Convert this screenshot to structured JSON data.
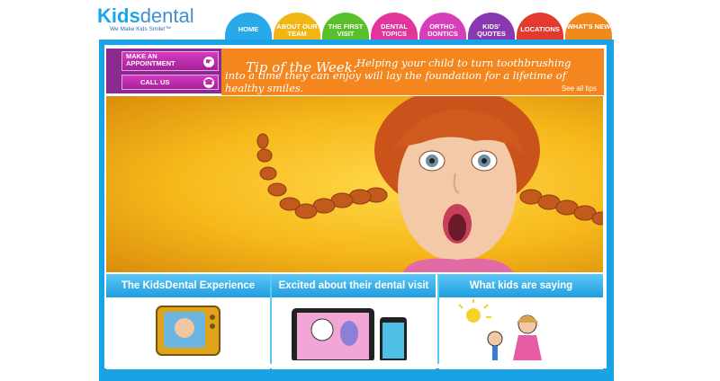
{
  "logo": {
    "brand_kids": "Kids",
    "brand_dental": "dental",
    "tagline": "We Make Kids Smile!™"
  },
  "nav": {
    "tabs": [
      {
        "label": "HOME",
        "color": "#2aa9ea"
      },
      {
        "label": "ABOUT OUR TEAM",
        "color": "#f1b615"
      },
      {
        "label": "THE FIRST VISIT",
        "color": "#59c02c"
      },
      {
        "label": "DENTAL TOPICS",
        "color": "#e2359b"
      },
      {
        "label": "ORTHO-DONTICS",
        "color": "#d73fb9"
      },
      {
        "label": "KIDS' QUOTES",
        "color": "#8a38b0"
      },
      {
        "label": "LOCATIONS",
        "color": "#e23a2f"
      },
      {
        "label": "WHAT'S NEW",
        "color": "#f08a1c"
      }
    ]
  },
  "actions": {
    "appointment": "MAKE AN APPOINTMENT",
    "call": "CALL US"
  },
  "tip": {
    "heading": "Tip of the Week:",
    "text": "Helping your child to turn toothbrushing into a time they can enjoy will lay the foundation for a lifetime of healthy smiles.",
    "see_all": "See all tips"
  },
  "sections": [
    {
      "title": "The KidsDental Experience"
    },
    {
      "title": "Excited about their dental visit"
    },
    {
      "title": "What kids are saying"
    }
  ],
  "colors": {
    "frame": "#1aa3e4",
    "purple": "#8b2a8f",
    "orange": "#f3861e"
  }
}
